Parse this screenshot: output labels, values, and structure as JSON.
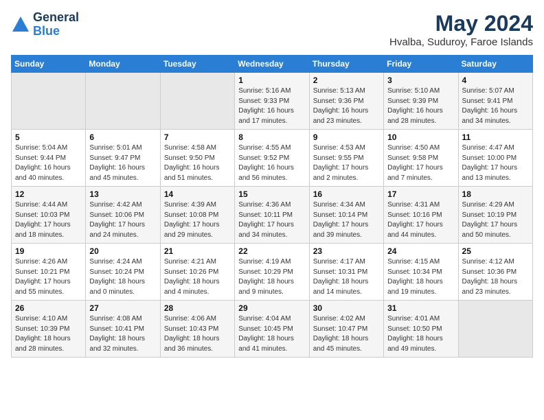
{
  "header": {
    "logo_general": "General",
    "logo_blue": "Blue",
    "title": "May 2024",
    "subtitle": "Hvalba, Suduroy, Faroe Islands"
  },
  "days_of_week": [
    "Sunday",
    "Monday",
    "Tuesday",
    "Wednesday",
    "Thursday",
    "Friday",
    "Saturday"
  ],
  "weeks": [
    [
      {
        "day": "",
        "info": ""
      },
      {
        "day": "",
        "info": ""
      },
      {
        "day": "",
        "info": ""
      },
      {
        "day": "1",
        "info": "Sunrise: 5:16 AM\nSunset: 9:33 PM\nDaylight: 16 hours\nand 17 minutes."
      },
      {
        "day": "2",
        "info": "Sunrise: 5:13 AM\nSunset: 9:36 PM\nDaylight: 16 hours\nand 23 minutes."
      },
      {
        "day": "3",
        "info": "Sunrise: 5:10 AM\nSunset: 9:39 PM\nDaylight: 16 hours\nand 28 minutes."
      },
      {
        "day": "4",
        "info": "Sunrise: 5:07 AM\nSunset: 9:41 PM\nDaylight: 16 hours\nand 34 minutes."
      }
    ],
    [
      {
        "day": "5",
        "info": "Sunrise: 5:04 AM\nSunset: 9:44 PM\nDaylight: 16 hours\nand 40 minutes."
      },
      {
        "day": "6",
        "info": "Sunrise: 5:01 AM\nSunset: 9:47 PM\nDaylight: 16 hours\nand 45 minutes."
      },
      {
        "day": "7",
        "info": "Sunrise: 4:58 AM\nSunset: 9:50 PM\nDaylight: 16 hours\nand 51 minutes."
      },
      {
        "day": "8",
        "info": "Sunrise: 4:55 AM\nSunset: 9:52 PM\nDaylight: 16 hours\nand 56 minutes."
      },
      {
        "day": "9",
        "info": "Sunrise: 4:53 AM\nSunset: 9:55 PM\nDaylight: 17 hours\nand 2 minutes."
      },
      {
        "day": "10",
        "info": "Sunrise: 4:50 AM\nSunset: 9:58 PM\nDaylight: 17 hours\nand 7 minutes."
      },
      {
        "day": "11",
        "info": "Sunrise: 4:47 AM\nSunset: 10:00 PM\nDaylight: 17 hours\nand 13 minutes."
      }
    ],
    [
      {
        "day": "12",
        "info": "Sunrise: 4:44 AM\nSunset: 10:03 PM\nDaylight: 17 hours\nand 18 minutes."
      },
      {
        "day": "13",
        "info": "Sunrise: 4:42 AM\nSunset: 10:06 PM\nDaylight: 17 hours\nand 24 minutes."
      },
      {
        "day": "14",
        "info": "Sunrise: 4:39 AM\nSunset: 10:08 PM\nDaylight: 17 hours\nand 29 minutes."
      },
      {
        "day": "15",
        "info": "Sunrise: 4:36 AM\nSunset: 10:11 PM\nDaylight: 17 hours\nand 34 minutes."
      },
      {
        "day": "16",
        "info": "Sunrise: 4:34 AM\nSunset: 10:14 PM\nDaylight: 17 hours\nand 39 minutes."
      },
      {
        "day": "17",
        "info": "Sunrise: 4:31 AM\nSunset: 10:16 PM\nDaylight: 17 hours\nand 44 minutes."
      },
      {
        "day": "18",
        "info": "Sunrise: 4:29 AM\nSunset: 10:19 PM\nDaylight: 17 hours\nand 50 minutes."
      }
    ],
    [
      {
        "day": "19",
        "info": "Sunrise: 4:26 AM\nSunset: 10:21 PM\nDaylight: 17 hours\nand 55 minutes."
      },
      {
        "day": "20",
        "info": "Sunrise: 4:24 AM\nSunset: 10:24 PM\nDaylight: 18 hours\nand 0 minutes."
      },
      {
        "day": "21",
        "info": "Sunrise: 4:21 AM\nSunset: 10:26 PM\nDaylight: 18 hours\nand 4 minutes."
      },
      {
        "day": "22",
        "info": "Sunrise: 4:19 AM\nSunset: 10:29 PM\nDaylight: 18 hours\nand 9 minutes."
      },
      {
        "day": "23",
        "info": "Sunrise: 4:17 AM\nSunset: 10:31 PM\nDaylight: 18 hours\nand 14 minutes."
      },
      {
        "day": "24",
        "info": "Sunrise: 4:15 AM\nSunset: 10:34 PM\nDaylight: 18 hours\nand 19 minutes."
      },
      {
        "day": "25",
        "info": "Sunrise: 4:12 AM\nSunset: 10:36 PM\nDaylight: 18 hours\nand 23 minutes."
      }
    ],
    [
      {
        "day": "26",
        "info": "Sunrise: 4:10 AM\nSunset: 10:39 PM\nDaylight: 18 hours\nand 28 minutes."
      },
      {
        "day": "27",
        "info": "Sunrise: 4:08 AM\nSunset: 10:41 PM\nDaylight: 18 hours\nand 32 minutes."
      },
      {
        "day": "28",
        "info": "Sunrise: 4:06 AM\nSunset: 10:43 PM\nDaylight: 18 hours\nand 36 minutes."
      },
      {
        "day": "29",
        "info": "Sunrise: 4:04 AM\nSunset: 10:45 PM\nDaylight: 18 hours\nand 41 minutes."
      },
      {
        "day": "30",
        "info": "Sunrise: 4:02 AM\nSunset: 10:47 PM\nDaylight: 18 hours\nand 45 minutes."
      },
      {
        "day": "31",
        "info": "Sunrise: 4:01 AM\nSunset: 10:50 PM\nDaylight: 18 hours\nand 49 minutes."
      },
      {
        "day": "",
        "info": ""
      }
    ]
  ]
}
